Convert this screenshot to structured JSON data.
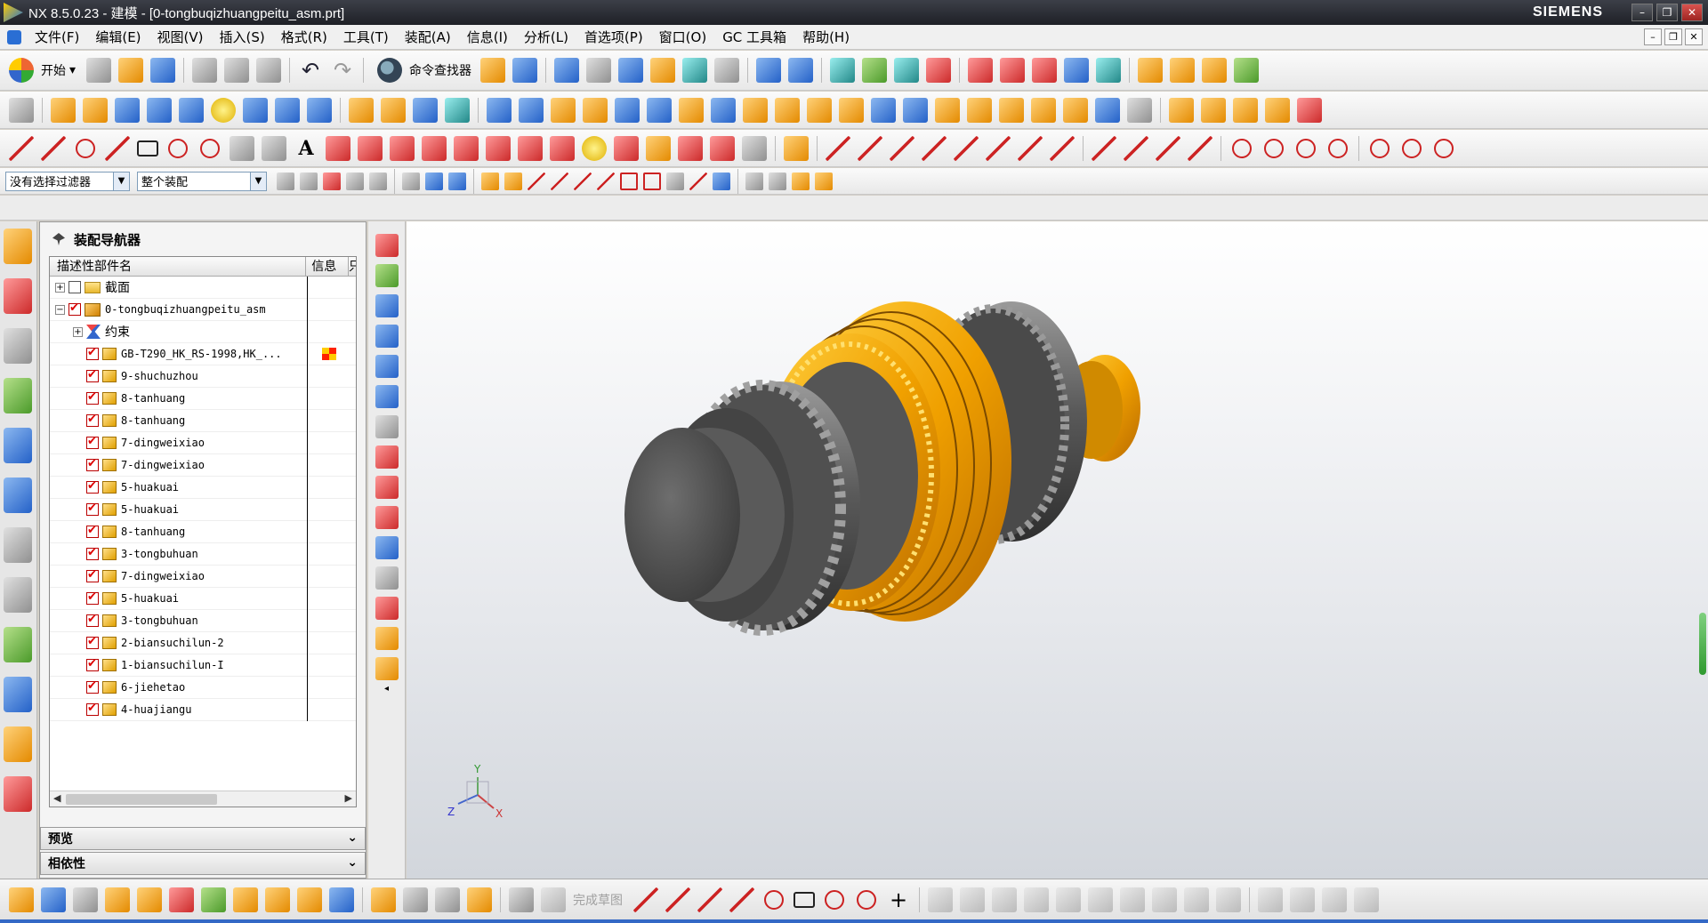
{
  "titlebar": {
    "title": "NX 8.5.0.23 - 建模 - [0-tongbuqizhuangpeitu_asm.prt]",
    "brand": "SIEMENS",
    "buttons": [
      "–",
      "❐",
      "✕"
    ]
  },
  "menubar": {
    "items": [
      "文件(F)",
      "编辑(E)",
      "视图(V)",
      "插入(S)",
      "格式(R)",
      "工具(T)",
      "装配(A)",
      "信息(I)",
      "分析(L)",
      "首选项(P)",
      "窗口(O)",
      "GC 工具箱",
      "帮助(H)"
    ],
    "doc_buttons": [
      "–",
      "❐",
      "✕"
    ]
  },
  "toolbar": {
    "start_label": "开始",
    "command_finder_label": "命令查找器"
  },
  "selection": {
    "filter_value": "没有选择过滤器",
    "scope_value": "整个装配"
  },
  "navigator": {
    "title": "装配导航器",
    "columns": [
      "描述性部件名",
      "信息",
      "只"
    ],
    "rows": [
      {
        "label": "截面",
        "type": "folder",
        "level": 0,
        "expander": "+",
        "checked": false,
        "info": false
      },
      {
        "label": "0-tongbuqizhuangpeitu_asm",
        "type": "assembly",
        "level": 0,
        "expander": "−",
        "checked": true,
        "info": false
      },
      {
        "label": "约束",
        "type": "constraint",
        "level": 1,
        "expander": "+",
        "checked": null,
        "info": false
      },
      {
        "label": "GB-T290_HK_RS-1998,HK_...",
        "type": "part",
        "level": 1,
        "expander": "",
        "checked": true,
        "info": true
      },
      {
        "label": "9-shuchuzhou",
        "type": "part",
        "level": 1,
        "expander": "",
        "checked": true,
        "info": false
      },
      {
        "label": "8-tanhuang",
        "type": "part",
        "level": 1,
        "expander": "",
        "checked": true,
        "info": false
      },
      {
        "label": "8-tanhuang",
        "type": "part",
        "level": 1,
        "expander": "",
        "checked": true,
        "info": false
      },
      {
        "label": "7-dingweixiao",
        "type": "part",
        "level": 1,
        "expander": "",
        "checked": true,
        "info": false
      },
      {
        "label": "7-dingweixiao",
        "type": "part",
        "level": 1,
        "expander": "",
        "checked": true,
        "info": false
      },
      {
        "label": "5-huakuai",
        "type": "part",
        "level": 1,
        "expander": "",
        "checked": true,
        "info": false
      },
      {
        "label": "5-huakuai",
        "type": "part",
        "level": 1,
        "expander": "",
        "checked": true,
        "info": false
      },
      {
        "label": "8-tanhuang",
        "type": "part",
        "level": 1,
        "expander": "",
        "checked": true,
        "info": false
      },
      {
        "label": "3-tongbuhuan",
        "type": "part",
        "level": 1,
        "expander": "",
        "checked": true,
        "info": false
      },
      {
        "label": "7-dingweixiao",
        "type": "part",
        "level": 1,
        "expander": "",
        "checked": true,
        "info": false
      },
      {
        "label": "5-huakuai",
        "type": "part",
        "level": 1,
        "expander": "",
        "checked": true,
        "info": false
      },
      {
        "label": "3-tongbuhuan",
        "type": "part",
        "level": 1,
        "expander": "",
        "checked": true,
        "info": false
      },
      {
        "label": "2-biansuchilun-2",
        "type": "part",
        "level": 1,
        "expander": "",
        "checked": true,
        "info": false
      },
      {
        "label": "1-biansuchilun-I",
        "type": "part",
        "level": 1,
        "expander": "",
        "checked": true,
        "info": false
      },
      {
        "label": "6-jiehetao",
        "type": "part",
        "level": 1,
        "expander": "",
        "checked": true,
        "info": false
      },
      {
        "label": "4-huajiangu",
        "type": "part",
        "level": 1,
        "expander": "",
        "checked": true,
        "info": false
      }
    ],
    "preview_label": "预览",
    "dependency_label": "相依性"
  },
  "bottombar": {
    "finish_sketch_label": "完成草图"
  },
  "triad": {
    "x": "X",
    "y": "Y",
    "z": "Z"
  },
  "colors": {
    "gear_dark": "#4a4a4a",
    "gear_light": "#8a8a8a",
    "sync_ring_orange": "#f0a000",
    "selection_red": "#cc0000"
  }
}
